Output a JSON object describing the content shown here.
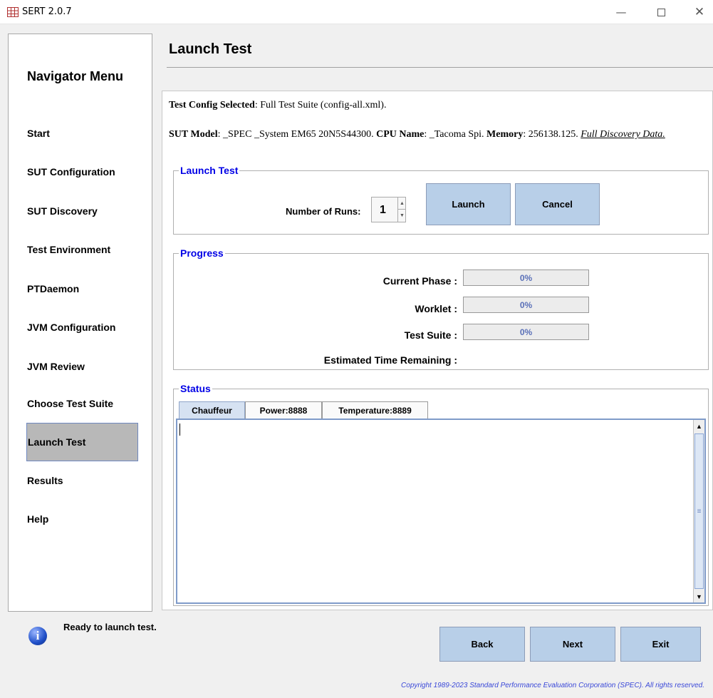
{
  "window": {
    "title": "SERT 2.0.7",
    "icons": [
      "app-grid-icon",
      "minimize-icon",
      "maximize-icon",
      "close-icon"
    ]
  },
  "nav": {
    "title": "Navigator Menu",
    "items": [
      {
        "label": "Start"
      },
      {
        "label": "SUT Configuration"
      },
      {
        "label": "SUT Discovery"
      },
      {
        "label": "Test Environment"
      },
      {
        "label": "PTDaemon"
      },
      {
        "label": "JVM Configuration"
      },
      {
        "label": "JVM Review"
      },
      {
        "label": "Choose Test Suite"
      },
      {
        "label": "Launch Test",
        "selected": true
      },
      {
        "label": "Results"
      },
      {
        "label": "Help"
      }
    ]
  },
  "page": {
    "title": "Launch Test"
  },
  "info": {
    "config_label": "Test Config Selected",
    "config_value": ": Full Test Suite (config-all.xml).",
    "sut_model_label": "SUT Model",
    "sut_model_value": ": _SPEC _System EM65 20N5S44300. ",
    "cpu_label": "CPU Name",
    "cpu_value": ": _Tacoma Spi. ",
    "memory_label": "Memory",
    "memory_value": ": 256138.125. ",
    "discovery_link": "Full Discovery Data."
  },
  "launch": {
    "legend": "Launch Test",
    "runs_label": "Number of Runs:",
    "runs_value": "1",
    "launch_button": "Launch",
    "cancel_button": "Cancel"
  },
  "progress": {
    "legend": "Progress",
    "current_phase_label": "Current Phase :",
    "current_phase_value": "0%",
    "worklet_label": "Worklet :",
    "worklet_value": "0%",
    "test_suite_label": "Test Suite :",
    "test_suite_value": "0%",
    "eta_label": "Estimated Time Remaining :"
  },
  "status": {
    "legend": "Status",
    "tabs": [
      "Chauffeur",
      "Power:8888",
      "Temperature:8889"
    ],
    "active_tab": "Chauffeur",
    "log_text": ""
  },
  "footer": {
    "message": "Ready to launch test.",
    "back_button": "Back",
    "next_button": "Next",
    "exit_button": "Exit",
    "copyright": "Copyright 1989-2023 Standard Performance Evaluation Corporation (SPEC). All rights reserved."
  },
  "colors": {
    "legend": "#0000e6",
    "button": "#b8cfe8",
    "selected_nav": "#b8b8b8",
    "progress_text": "#5a70b8",
    "copyright": "#3a48d8"
  }
}
